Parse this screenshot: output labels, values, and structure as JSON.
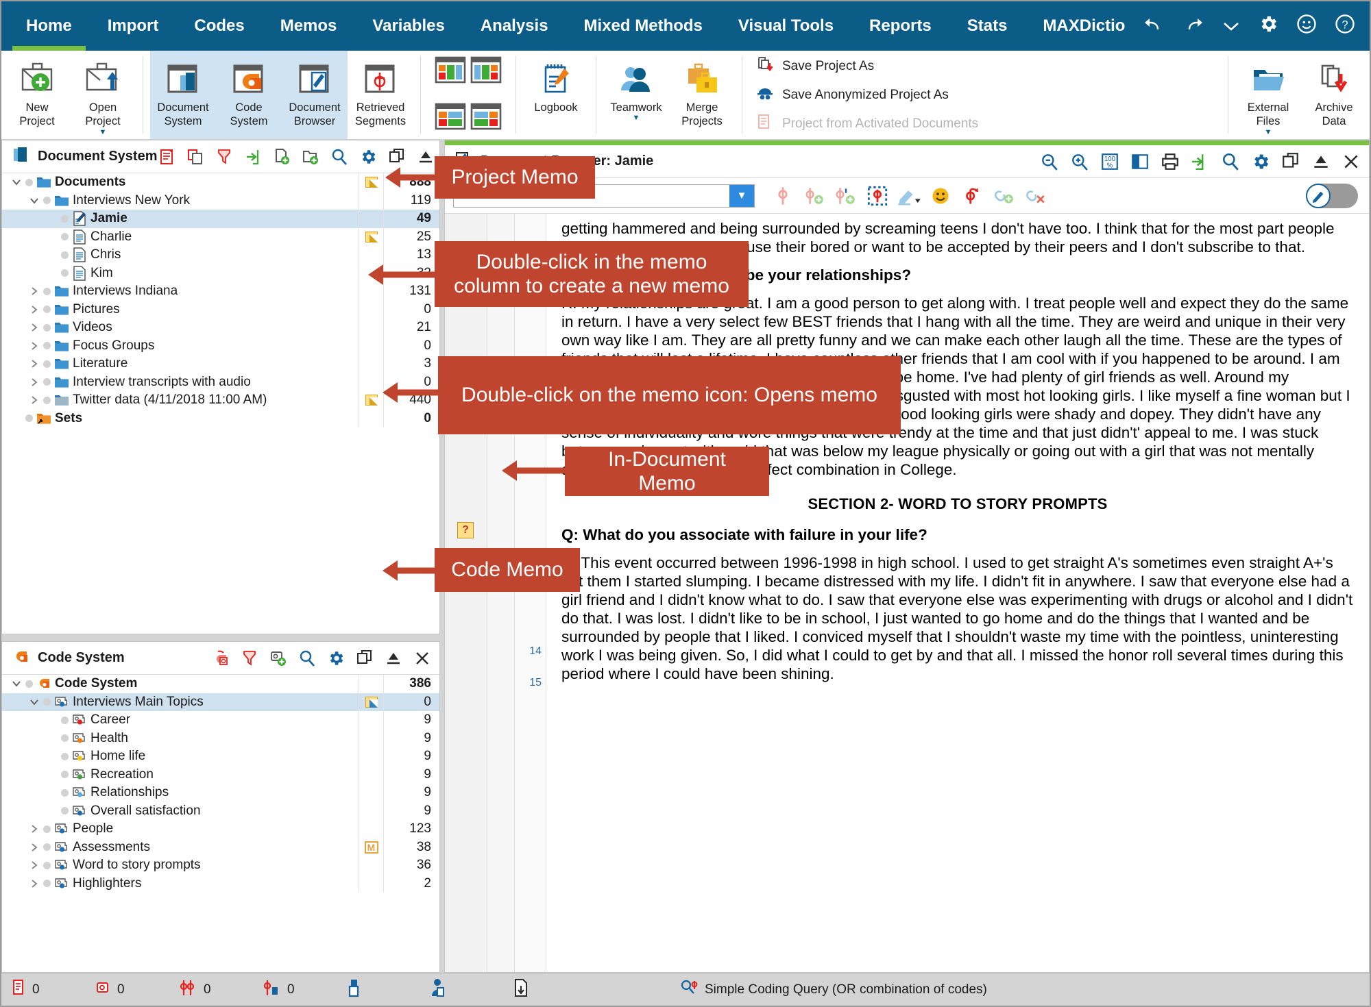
{
  "ribbon": {
    "tabs": [
      {
        "label": "Home",
        "active": true
      },
      {
        "label": "Import",
        "active": false
      },
      {
        "label": "Codes",
        "active": false
      },
      {
        "label": "Memos",
        "active": false
      },
      {
        "label": "Variables",
        "active": false
      },
      {
        "label": "Analysis",
        "active": false
      },
      {
        "label": "Mixed Methods",
        "active": false
      },
      {
        "label": "Visual Tools",
        "active": false
      },
      {
        "label": "Reports",
        "active": false
      },
      {
        "label": "Stats",
        "active": false
      },
      {
        "label": "MAXDictio",
        "active": false
      }
    ],
    "right_icons": [
      "undo-icon",
      "redo-icon",
      "chevron-down-icon",
      "gear-icon",
      "smiley-icon",
      "help-icon"
    ],
    "buttons": {
      "new_project": "New\nProject",
      "new_project_l1": "New",
      "new_project_l2": "Project",
      "open_project_l1": "Open",
      "open_project_l2": "Project",
      "document_system_l1": "Document",
      "document_system_l2": "System",
      "code_system_l1": "Code",
      "code_system_l2": "System",
      "document_browser_l1": "Document",
      "document_browser_l2": "Browser",
      "retrieved_segments_l1": "Retrieved",
      "retrieved_segments_l2": "Segments",
      "logbook": "Logbook",
      "teamwork": "Teamwork",
      "merge_projects_l1": "Merge",
      "merge_projects_l2": "Projects",
      "external_files_l1": "External",
      "external_files_l2": "Files",
      "archive_data_l1": "Archive",
      "archive_data_l2": "Data"
    },
    "save_list": [
      {
        "label": "Save Project As",
        "icon": "save-project-icon",
        "disabled": false
      },
      {
        "label": "Save Anonymized Project As",
        "icon": "anonymize-icon",
        "disabled": false
      },
      {
        "label": "Project from Activated Documents",
        "icon": "project-activated-icon",
        "disabled": true
      }
    ]
  },
  "document_system": {
    "title": "Document System",
    "tools": [
      "paste-icon",
      "copy-icon",
      "filter-icon",
      "activate-icon",
      "new-document-icon",
      "new-group-icon",
      "search-icon",
      "gear-icon",
      "detach-icon",
      "collapse-icon",
      "close-icon"
    ],
    "rows": [
      {
        "label": "Documents",
        "indent": 0,
        "twisty": "down",
        "icon": "folder-blue-icon",
        "bold": true,
        "memo": "memo-yellow",
        "count": "888"
      },
      {
        "label": "Interviews New York",
        "indent": 1,
        "twisty": "down",
        "icon": "folder-blue-icon",
        "bold": false,
        "memo": "",
        "count": "119"
      },
      {
        "label": "Jamie",
        "indent": 2,
        "twisty": "",
        "icon": "document-memo-icon",
        "bold": true,
        "memo": "",
        "count": "49",
        "selected": true
      },
      {
        "label": "Charlie",
        "indent": 2,
        "twisty": "",
        "icon": "document-icon",
        "bold": false,
        "memo": "memo-yellow",
        "count": "25"
      },
      {
        "label": "Chris",
        "indent": 2,
        "twisty": "",
        "icon": "document-icon",
        "bold": false,
        "memo": "",
        "count": "13"
      },
      {
        "label": "Kim",
        "indent": 2,
        "twisty": "",
        "icon": "document-icon",
        "bold": false,
        "memo": "",
        "count": "32"
      },
      {
        "label": "Interviews Indiana",
        "indent": 1,
        "twisty": "right",
        "icon": "folder-blue-icon",
        "bold": false,
        "memo": "",
        "count": "131"
      },
      {
        "label": "Pictures",
        "indent": 1,
        "twisty": "right",
        "icon": "folder-blue-icon",
        "bold": false,
        "memo": "",
        "count": "0"
      },
      {
        "label": "Videos",
        "indent": 1,
        "twisty": "right",
        "icon": "folder-blue-icon",
        "bold": false,
        "memo": "",
        "count": "21"
      },
      {
        "label": "Focus Groups",
        "indent": 1,
        "twisty": "right",
        "icon": "folder-blue-icon",
        "bold": false,
        "memo": "",
        "count": "0"
      },
      {
        "label": "Literature",
        "indent": 1,
        "twisty": "right",
        "icon": "folder-blue-icon",
        "bold": false,
        "memo": "",
        "count": "3"
      },
      {
        "label": "Interview transcripts with audio",
        "indent": 1,
        "twisty": "right",
        "icon": "folder-blue-icon",
        "bold": false,
        "memo": "",
        "count": "0"
      },
      {
        "label": "Twitter data (4/11/2018 11:00 AM)",
        "indent": 1,
        "twisty": "right",
        "icon": "folder-gray-icon",
        "bold": false,
        "memo": "memo-yellow",
        "count": "440"
      },
      {
        "label": "Sets",
        "indent": 0,
        "twisty": "",
        "icon": "folder-orange-icon",
        "bold": true,
        "memo": "",
        "count": "0"
      }
    ]
  },
  "code_system": {
    "title": "Code System",
    "tools": [
      "undo-code-icon",
      "filter-icon",
      "new-code-icon",
      "search-icon",
      "gear-icon",
      "detach-icon",
      "collapse-icon",
      "close-icon"
    ],
    "rows": [
      {
        "label": "Code System",
        "indent": 0,
        "twisty": "down",
        "icon": "code-system-icon",
        "color": "",
        "bold": true,
        "memo": "",
        "count": "386"
      },
      {
        "label": "Interviews Main Topics",
        "indent": 1,
        "twisty": "down",
        "icon": "code-icon",
        "color": "#1f6fb4",
        "bold": false,
        "memo": "memo-blue",
        "count": "0",
        "selected": true
      },
      {
        "label": "Career",
        "indent": 2,
        "twisty": "",
        "icon": "code-icon",
        "color": "#e5211e",
        "bold": false,
        "memo": "",
        "count": "9"
      },
      {
        "label": "Health",
        "indent": 2,
        "twisty": "",
        "icon": "code-icon",
        "color": "#f07c14",
        "bold": false,
        "memo": "",
        "count": "9"
      },
      {
        "label": "Home life",
        "indent": 2,
        "twisty": "",
        "icon": "code-icon",
        "color": "#f5c518",
        "bold": false,
        "memo": "",
        "count": "9"
      },
      {
        "label": "Recreation",
        "indent": 2,
        "twisty": "",
        "icon": "code-icon",
        "color": "#3fa435",
        "bold": false,
        "memo": "",
        "count": "9"
      },
      {
        "label": "Relationships",
        "indent": 2,
        "twisty": "",
        "icon": "code-icon",
        "color": "#5aacdf",
        "bold": false,
        "memo": "",
        "count": "9"
      },
      {
        "label": "Overall satisfaction",
        "indent": 2,
        "twisty": "",
        "icon": "code-icon",
        "color": "#1f6fb4",
        "bold": false,
        "memo": "",
        "count": "9"
      },
      {
        "label": "People",
        "indent": 1,
        "twisty": "right",
        "icon": "code-icon",
        "color": "#1f6fb4",
        "bold": false,
        "memo": "",
        "count": "123"
      },
      {
        "label": "Assessments",
        "indent": 1,
        "twisty": "right",
        "icon": "code-icon",
        "color": "#1f6fb4",
        "bold": false,
        "memo": "memo-m",
        "count": "38"
      },
      {
        "label": "Word to story prompts",
        "indent": 1,
        "twisty": "right",
        "icon": "code-icon",
        "color": "#1f6fb4",
        "bold": false,
        "memo": "",
        "count": "36"
      },
      {
        "label": "Highlighters",
        "indent": 1,
        "twisty": "right",
        "icon": "code-icon",
        "color": "#1f6fb4",
        "bold": false,
        "memo": "",
        "count": "2"
      }
    ]
  },
  "document_browser": {
    "title": "Document Browser: Jamie",
    "head_tools": [
      "zoom-out-icon",
      "zoom-in-icon",
      "zoom-100-icon",
      "split-view-icon",
      "print-icon",
      "export-icon",
      "search-icon",
      "gear-icon",
      "detach-icon",
      "collapse-icon",
      "close-icon"
    ],
    "toolbar": {
      "code_combo_value": "",
      "icons": [
        "code-icon",
        "code-add-icon",
        "code-inline-add-icon",
        "code-region-icon",
        "highlighter-icon",
        "emoticode-icon",
        "undo-code-icon",
        "link-add-icon",
        "link-remove-icon"
      ],
      "edit_toggle": "pencil-toggle"
    },
    "in_document_memo": "?",
    "line_numbers": [
      "14",
      "15"
    ],
    "paragraphs": [
      "getting hammered and being surrounded by screaming teens I don't have too. I think that for the most part people engage in this activity because their bored or want to be accepted by their peers and I don't subscribe to that.",
      "Q: How would you describe your relationships?",
      "R: My relationships are great. I am a good person to get along with. I treat people well and expect they do the same in return. I have a very select few BEST friends that I hang with all the time. They are weird and unique in their very own way like I am. They are all pretty funny and we can make each other laugh all the time. These are the types of friends that will last a lifetime. I have countless other friends that I am cool with if you happened to be around. I am comfortable coming over when you happened to be home. I've had plenty of girl friends as well. Around my sophomore year of school that I started getting disgusted with most hot looking girls. I like myself a fine woman but I gravitated to the dark side in high school. All the good looking girls were shady and dopey. They didn't have any sense of individuality and wore things that were trendy at the time and that just didn't' appeal to me. I was stuck between going out with a girl that was below my league physically or going out with a girl that was not mentally appealing. I finally found a perfect combination in College."
    ],
    "section_heading": "SECTION 2- WORD TO STORY PROMPTS",
    "question": "Q: What do you associate with failure in your life?",
    "answer": "R: This event occurred between 1996-1998 in high school. I used to get straight A's sometimes even straight A+'s but them I started slumping. I became distressed with my life. I didn't fit in anywhere. I saw that everyone else had a girl friend and I didn't know what to do. I saw that everyone else was experimenting with drugs or alcohol and I didn't do that. I was lost. I didn't like to be in school, I just wanted to go home and do the things that I wanted and be surrounded by people that I liked. I conviced myself that I shouldn't waste my time with the pointless, uninteresting work I was being given. So, I did what I could to get by and that all. I missed the honor roll several times during this period where I could have been shining."
  },
  "status_bar": {
    "items": [
      {
        "icon": "documents-count-icon",
        "value": "0"
      },
      {
        "icon": "codes-count-icon",
        "value": "0"
      },
      {
        "icon": "coded-segments-icon",
        "value": "0"
      },
      {
        "icon": "active-segments-icon",
        "value": "0"
      },
      {
        "icon": "docs-person-icon",
        "value": ""
      },
      {
        "icon": "person-icon",
        "value": ""
      },
      {
        "icon": "export-doc-icon",
        "value": ""
      }
    ],
    "query": "Simple Coding Query (OR combination of codes)",
    "query_icon": "coding-query-icon"
  },
  "callouts": [
    {
      "text": "Project Memo",
      "id": "project-memo"
    },
    {
      "text": "Double-click in the memo column to create a new memo",
      "id": "new-memo"
    },
    {
      "text": "Double-click on the memo icon: Opens memo",
      "id": "open-memo"
    },
    {
      "text": "In-Document Memo",
      "id": "in-doc-memo"
    },
    {
      "text": "Code Memo",
      "id": "code-memo"
    }
  ],
  "colors": {
    "ribbon_blue": "#0b5c87",
    "accent_green": "#7ac143",
    "callout_red": "#c0452f",
    "selection_blue": "#cfe0ef"
  }
}
